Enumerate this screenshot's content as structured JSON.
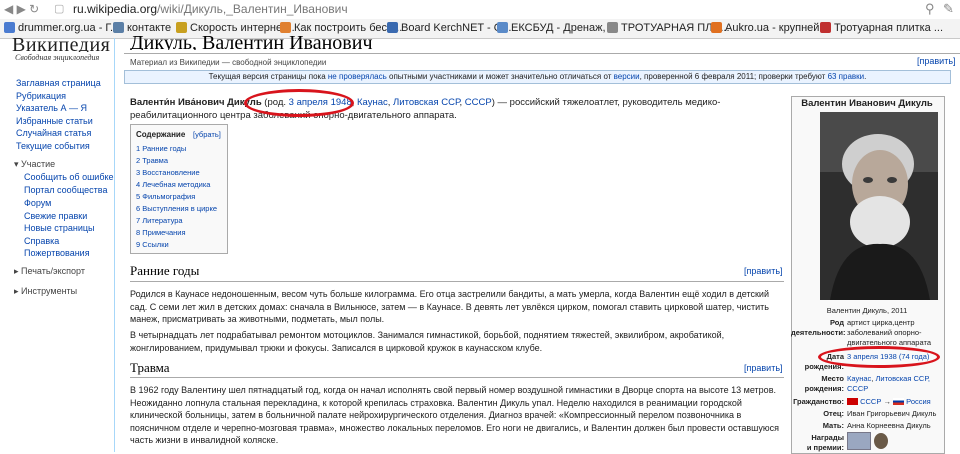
{
  "browser": {
    "url_prefix": "ru.wikipedia.org",
    "url_path": "/wiki/Дикуль,_Валентин_Иванович",
    "bookmarks": [
      {
        "label": "drummer.org.ua - Г...",
        "color": "#4a7bd0"
      },
      {
        "label": "контакте",
        "color": "#5b7fa6"
      },
      {
        "label": "Скорость интернет...",
        "color": "#c8a020"
      },
      {
        "label": "Как построить бесе...",
        "color": "#e08030"
      },
      {
        "label": "Board KerchNET - О...",
        "color": "#3a6ab0"
      },
      {
        "label": "ЕКСБУД - Дренаж, ...",
        "color": "#5a8ac8"
      },
      {
        "label": "ТРОТУАРНАЯ ПЛИ...",
        "color": "#888888"
      },
      {
        "label": "Aukro.ua - крупней...",
        "color": "#e07020"
      },
      {
        "label": "Тротуарная плитка ...",
        "color": "#c03030"
      }
    ]
  },
  "sidebar": {
    "logo": "Википедия",
    "logo_sub": "Свободная энциклопедия",
    "nav": [
      "Заглавная страница",
      "Рубрикация",
      "Указатель А — Я",
      "Избранные статьи",
      "Случайная статья",
      "Текущие события"
    ],
    "participation_title": "Участие",
    "participation": [
      "Сообщить об ошибке",
      "Портал сообщества",
      "Форум",
      "Свежие правки",
      "Новые страницы",
      "Справка",
      "Пожертвования"
    ],
    "print_title": "Печать/экспорт",
    "tools_title": "Инструменты"
  },
  "article": {
    "title": "Дикуль, Валентин Иванович",
    "from": "Материал из Википедии — свободной энциклопедии",
    "edit": "[править]",
    "notice": {
      "p1": "Текущая версия страницы пока ",
      "l1": "не проверялась",
      "p2": " опытными участниками и может значительно отличаться от ",
      "l2": "версии",
      "p3": ", проверенной 6 февраля 2011; проверки требуют ",
      "l3": "63 правки",
      "p4": "."
    },
    "lead": {
      "name": "Валенти́н Ива́нович Дику́ль",
      "p1": " (род. ",
      "l1": "3 апреля",
      "l2": "1948",
      "sep1": ", ",
      "l3": "Каунас",
      "sep2": ", ",
      "l4": "Литовская ССР",
      "sep3": ", ",
      "l5": "СССР",
      "p2": ") — российский тяжелоатлет, руководитель медико-реабилитационного центра заболеваний опорно-двигательного аппарата."
    },
    "toc": {
      "title": "Содержание",
      "hide": "[убрать]",
      "items": [
        "1 Ранние годы",
        "2 Травма",
        "3 Восстановление",
        "4 Лечебная методика",
        "5 Фильмография",
        "6 Выступления в цирке",
        "7 Литература",
        "8 Примечания",
        "9 Ссылки"
      ]
    },
    "s1_title": "Ранние годы",
    "s1_p1": "Родился в Каунасе недоношенным, весом чуть больше килограмма. Его отца застрелили бандиты, а мать умерла, когда Валентин ещё ходил в детский сад. С семи лет жил в детских домах: сначала в Вильнюсе, затем — в Каунасе. В девять лет увлёкся цирком, помогал ставить цирковой шатер, чистить манеж, присматривать за животными, подметать, мыл полы.",
    "s1_p2": "В четырнадцать лет подрабатывал ремонтом мотоциклов. Занимался гимнастикой, борьбой, поднятием тяжестей, эквилибром, акробатикой, жонглированием, придумывал трюки и фокусы. Записался в цирковой кружок в каунасском клубе.",
    "s2_title": "Травма",
    "s2_p1": "В 1962 году Валентину шел пятнадцатый год, когда он начал исполнять свой первый номер воздушной гимнастики в Дворце спорта на высоте 13 метров. Неожиданно лопнула стальная перекладина, к которой крепилась страховка. Валентин Дикуль упал. Неделю находился в реанимации городской клинической больницы, затем в больничной палате нейрохирургического отделения. Диагноз врачей: «Компрессионный перелом позвоночника в поясничном отделе и черепно-мозговая травма», множество локальных переломов. Его ноги не двигались, и Валентин должен был провести оставшуюся часть жизни в инвалидной коляске."
  },
  "infobox": {
    "title": "Валентин Иванович Дикуль",
    "caption": "Валентин Дикуль, 2011",
    "occupation_label": "Род",
    "occupation_label2": "деятельности:",
    "occupation": [
      "артист цирка,центр",
      "заболеваний опорно-",
      "двигательного аппарата"
    ],
    "birthdate_label": "Дата",
    "birthdate_label2": "рождения:",
    "birthdate": "3 апреля 1938 (74 года)",
    "birthplace_label": "Место",
    "birthplace_label2": "рождения:",
    "birthplace_1": "Каунас",
    "birthplace_sep": ", ",
    "birthplace_2": "Литовская ССР,",
    "birthplace_3": "СССР",
    "citizenship_label": "Гражданство:",
    "citizenship_1": "СССР",
    "citizenship_arrow": "→",
    "citizenship_2": "Россия",
    "father_label": "Отец:",
    "father": "Иван Григорьевич Дикуль",
    "mother_label": "Мать:",
    "mother": "Анна Корнеевна Дикуль",
    "awards_label": "Награды",
    "awards_label2": "и премии:"
  },
  "annotation_color": "#d8141c"
}
